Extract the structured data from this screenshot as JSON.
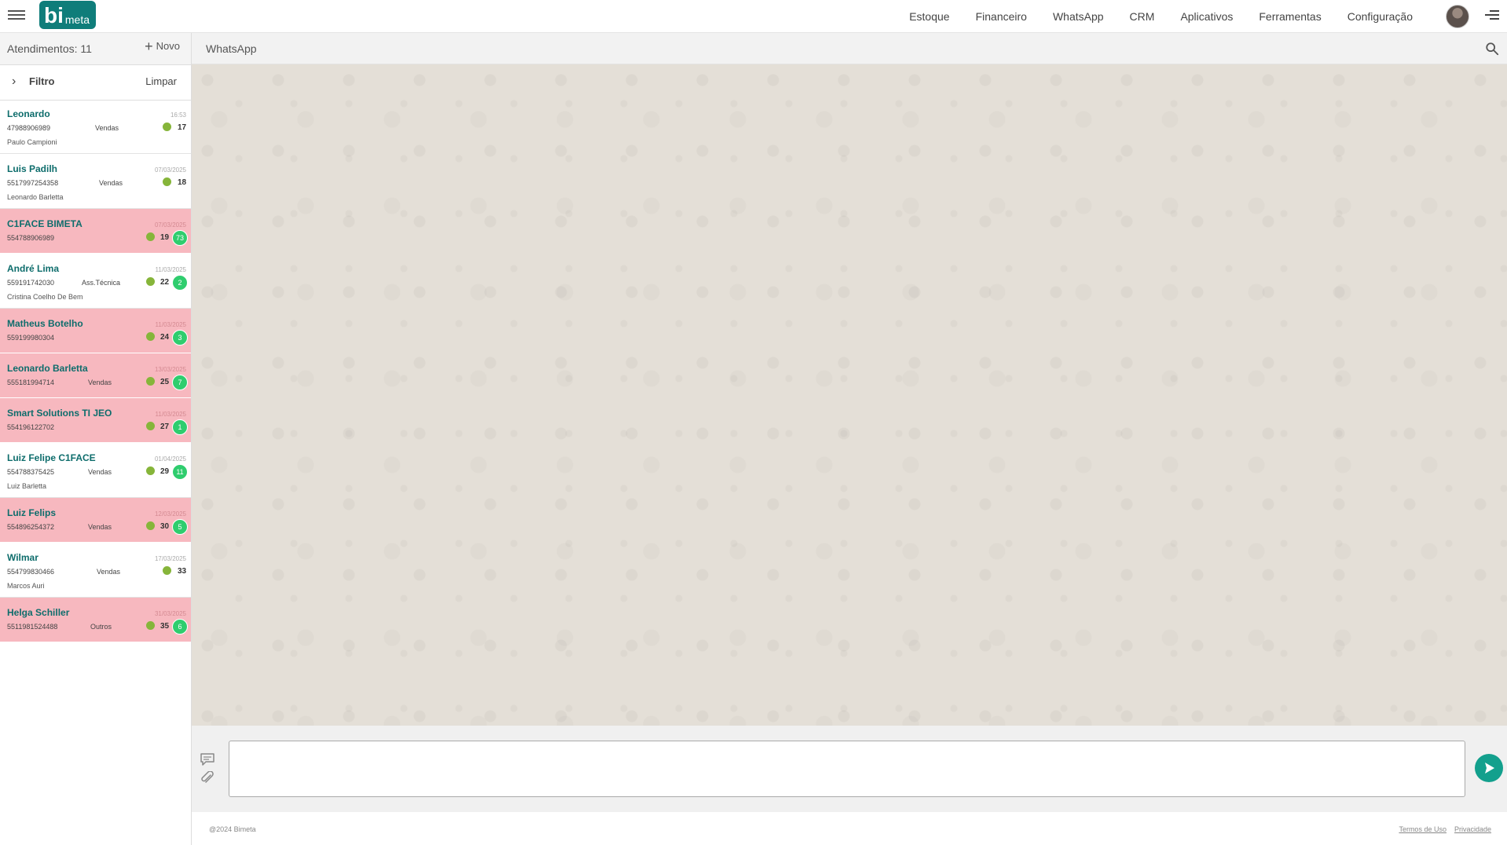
{
  "header": {
    "logo_bi": "bi",
    "logo_meta": "meta",
    "nav": [
      "Estoque",
      "Financeiro",
      "WhatsApp",
      "CRM",
      "Aplicativos",
      "Ferramentas",
      "Configuração"
    ],
    "brand_color": "#0f7d7a"
  },
  "sidebar": {
    "count_label": "Atendimentos: 11",
    "new_label": "Novo",
    "filter_label": "Filtro",
    "clear_label": "Limpar",
    "items": [
      {
        "name": "Leonardo",
        "phone": "47988906989",
        "dept": "Vendas",
        "agent": "Paulo Campioni",
        "date": "16:53",
        "num": "17",
        "badge": "",
        "alert": false
      },
      {
        "name": "Luis Padilh",
        "phone": "5517997254358",
        "dept": "Vendas",
        "agent": "Leonardo Barletta",
        "date": "07/03/2025",
        "num": "18",
        "badge": "",
        "alert": false
      },
      {
        "name": "C1FACE BIMETA",
        "phone": "554788906989",
        "dept": "",
        "agent": "",
        "date": "07/03/2025",
        "num": "19",
        "badge": "73",
        "alert": true
      },
      {
        "name": "André Lima",
        "phone": "559191742030",
        "dept": "Ass.Técnica",
        "agent": "Cristina Coelho De Bem",
        "date": "11/03/2025",
        "num": "22",
        "badge": "2",
        "alert": false
      },
      {
        "name": "Matheus Botelho",
        "phone": "559199980304",
        "dept": "",
        "agent": "",
        "date": "11/03/2025",
        "num": "24",
        "badge": "3",
        "alert": true
      },
      {
        "name": "Leonardo Barletta",
        "phone": "555181994714",
        "dept": "Vendas",
        "agent": "",
        "date": "13/03/2025",
        "num": "25",
        "badge": "7",
        "alert": true
      },
      {
        "name": "Smart Solutions TI JEO",
        "phone": "554196122702",
        "dept": "",
        "agent": "",
        "date": "11/03/2025",
        "num": "27",
        "badge": "1",
        "alert": true
      },
      {
        "name": "Luiz Felipe C1FACE",
        "phone": "554788375425",
        "dept": "Vendas",
        "agent": "Luiz Barletta",
        "date": "01/04/2025",
        "num": "29",
        "badge": "11",
        "alert": false
      },
      {
        "name": "Luiz Felips",
        "phone": "554896254372",
        "dept": "Vendas",
        "agent": "",
        "date": "12/03/2025",
        "num": "30",
        "badge": "5",
        "alert": true
      },
      {
        "name": "Wilmar",
        "phone": "554799830466",
        "dept": "Vendas",
        "agent": "Marcos Auri",
        "date": "17/03/2025",
        "num": "33",
        "badge": "",
        "alert": false
      },
      {
        "name": "Helga Schiller",
        "phone": "5511981524488",
        "dept": "Outros",
        "agent": "",
        "date": "31/03/2025",
        "num": "35",
        "badge": "6",
        "alert": true
      }
    ]
  },
  "chat": {
    "title": "WhatsApp",
    "input_value": "",
    "send_color": "#13a08d"
  },
  "footer": {
    "copyright": "@2024 Bimeta",
    "terms": "Termos de Uso",
    "privacy": "Privacidade"
  },
  "icons": [
    "hamburger-icon",
    "menu-icon",
    "search-icon",
    "message-icon",
    "paperclip-icon",
    "send-icon",
    "chevron-right-icon",
    "plus-icon"
  ]
}
